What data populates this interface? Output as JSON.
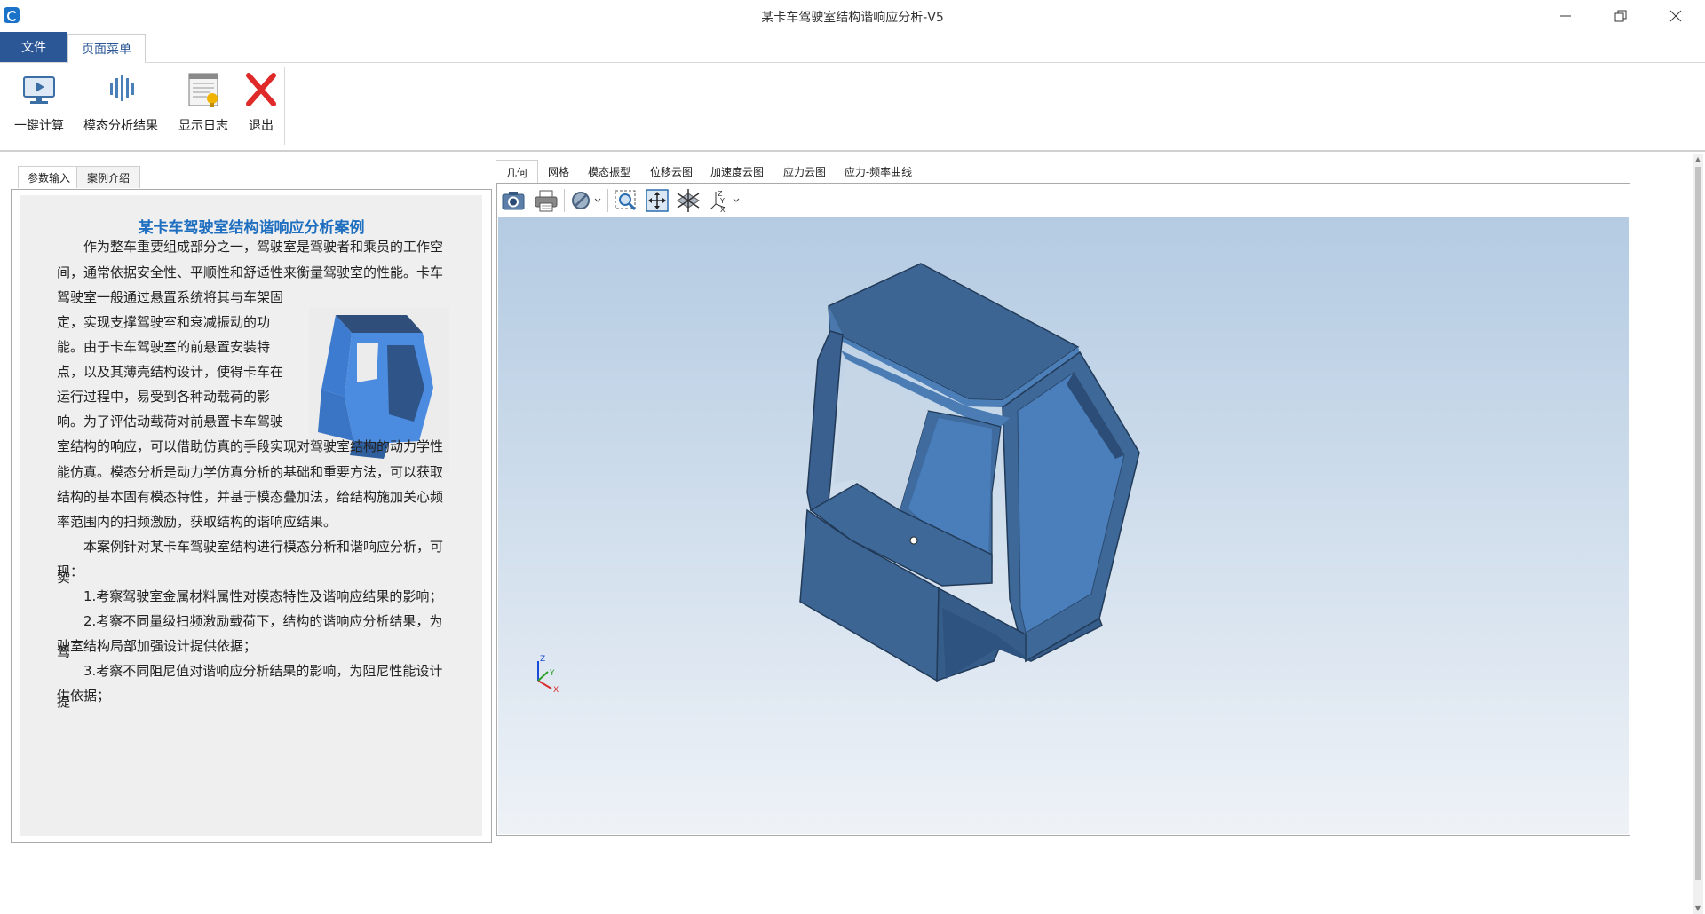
{
  "window": {
    "title": "某卡车驾驶室结构谐响应分析-V5",
    "minimize_icon": "minimize-icon",
    "restore_icon": "restore-icon",
    "close_icon": "close-icon"
  },
  "menu": {
    "file": "文件",
    "page_menu": "页面菜单"
  },
  "ribbon": {
    "items": [
      {
        "label": "一键计算",
        "icon": "monitor-play-icon"
      },
      {
        "label": "模态分析结果",
        "icon": "bars-chart-icon"
      },
      {
        "label": "显示日志",
        "icon": "log-document-icon"
      },
      {
        "label": "退出",
        "icon": "red-x-icon"
      }
    ]
  },
  "left_tabs": [
    "参数输入",
    "案例介绍"
  ],
  "case": {
    "title": "某卡车驾驶室结构谐响应分析案例",
    "lines": [
      "作为整车重要组成部分之一，驾驶室是驾驶者和乘员的工作空",
      "间，通常依据安全性、平顺性和舒适性来衡量驾驶室的性能。卡车",
      "驾驶室一般通过悬置系统将其与车架固",
      "定，实现支撑驾驶室和衰减振动的功",
      "能。由于卡车驾驶室的前悬置安装特",
      "点，以及其薄壳结构设计，使得卡车在",
      "运行过程中，易受到各种动载荷的影",
      "响。为了评估动载荷对前悬置卡车驾驶",
      "室结构的响应，可以借助仿真的手段实现对驾驶室结构的动力学性",
      "能仿真。模态分析是动力学仿真分析的基础和重要方法，可以获取",
      "结构的基本固有模态特性，并基于模态叠加法，给结构施加关心频",
      "率范围内的扫频激励，获取结构的谐响应结果。",
      "本案例针对某卡车驾驶室结构进行模态分析和谐响应分析，可实",
      "现：",
      "1.考察驾驶室金属材料属性对模态特性及谐响应结果的影响；",
      "2.考察不同量级扫频激励载荷下，结构的谐响应分析结果，为驾",
      "驶室结构局部加强设计提供依据；",
      "3.考察不同阻尼值对谐响应分析结果的影响，为阻尼性能设计提",
      "供依据；"
    ]
  },
  "view_tabs": [
    "几何",
    "网格",
    "模态振型",
    "位移云图",
    "加速度云图",
    "应力云图",
    "应力-频率曲线"
  ],
  "view_toolbar": [
    "camera-icon",
    "print-icon",
    "no-display-icon",
    "zoom-region-icon",
    "fit-all-icon",
    "view-plane-icon",
    "axis-orient-icon"
  ],
  "triad": {
    "x": "X",
    "y": "Y",
    "z": "Z"
  },
  "colors": {
    "accent": "#2b5797",
    "model": "#3e6797",
    "viewport_top": "#b4cbe2",
    "viewport_bottom": "#eef2f7"
  }
}
